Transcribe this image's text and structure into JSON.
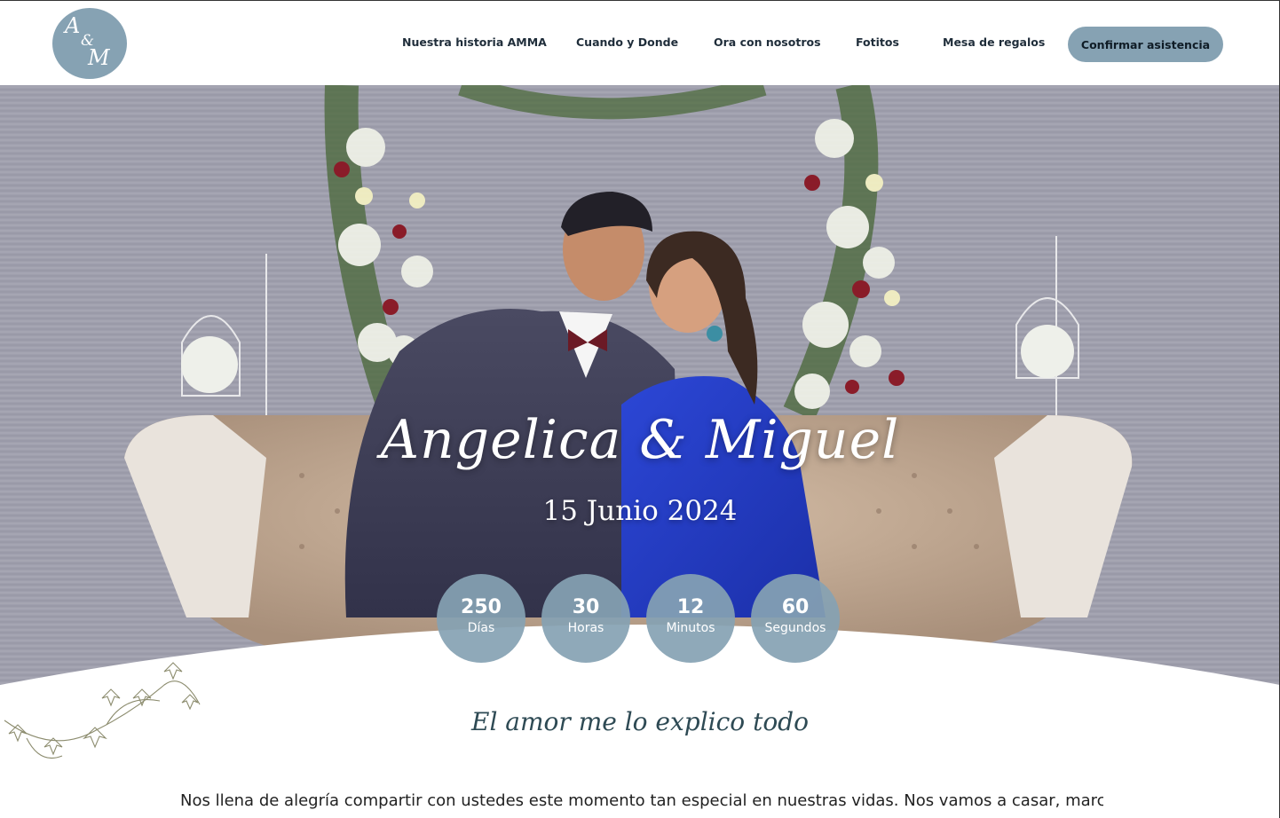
{
  "logo": {
    "line1": "A",
    "line2": "&",
    "line3": "M"
  },
  "nav": {
    "items": [
      {
        "label": "Nuestra historia AMMA"
      },
      {
        "label": "Cuando y Donde"
      },
      {
        "label": "Ora con nosotros"
      },
      {
        "label": "Fotitos"
      },
      {
        "label": "Mesa de regalos"
      }
    ],
    "cta_label": "Confirmar asistencia"
  },
  "hero": {
    "names": "Angelica & Miguel",
    "date": "15 Junio 2024"
  },
  "countdown": [
    {
      "value": "250",
      "unit": "Días"
    },
    {
      "value": "30",
      "unit": "Horas"
    },
    {
      "value": "12",
      "unit": "Minutos"
    },
    {
      "value": "60",
      "unit": "Segundos"
    }
  ],
  "content": {
    "tagline": "El amor me lo explico todo",
    "intro": "Nos llena de alegría compartir con ustedes este momento tan especial en nuestras vidas. Nos vamos a casar, marcando el"
  },
  "colors": {
    "accent": "#86a2b3",
    "header_bg": "#ffffff",
    "text_dark": "#1f2d3a"
  }
}
